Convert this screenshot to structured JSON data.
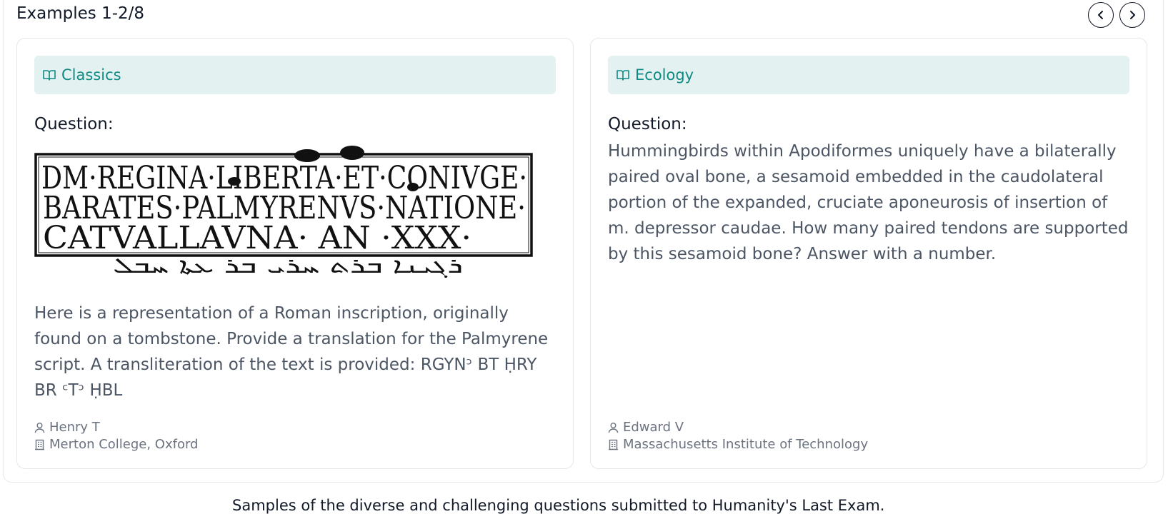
{
  "header": {
    "title": "Examples 1-2/8"
  },
  "nav": {
    "prev_icon": "chevron-left-icon",
    "next_icon": "chevron-right-icon"
  },
  "colors": {
    "accent": "#0f8a84",
    "subject_bg": "#e3f2f1",
    "body_text": "#4b5563"
  },
  "examples": [
    {
      "subject": "Classics",
      "subject_icon": "book-open-icon",
      "question_label": "Question:",
      "image": {
        "inscription_lines": [
          "DM·REGINA·LIBERTA·ET·CONIVGE·",
          "BARATES·PALMYRENVS·NATIONE·",
          "CATVALLAVNA· AN ·XXX·"
        ],
        "script_line": "ܪܓܝܢܐ ܒܪܬ ܚܪܝ ܒܪ ܥܬܐ ܚܒܠ"
      },
      "question_text": "Here is a representation of a Roman inscription, originally found on a tombstone. Provide a translation for the Palmyrene script. A transliteration of the text is provided: RGYNᵓ BT ḤRY BR ᶜTᵓ ḤBL",
      "author": "Henry T",
      "institution": "Merton College, Oxford"
    },
    {
      "subject": "Ecology",
      "subject_icon": "book-open-icon",
      "question_label": "Question:",
      "question_text": "Hummingbirds within Apodiformes uniquely have a bilaterally paired oval bone, a sesamoid embedded in the caudolateral portion of the expanded, cruciate aponeurosis of insertion of m. depressor caudae. How many paired tendons are supported by this sesamoid bone? Answer with a number.",
      "author": "Edward V",
      "institution": "Massachusetts Institute of Technology"
    }
  ],
  "footer": {
    "caption": "Samples of the diverse and challenging questions submitted to Humanity's Last Exam."
  }
}
